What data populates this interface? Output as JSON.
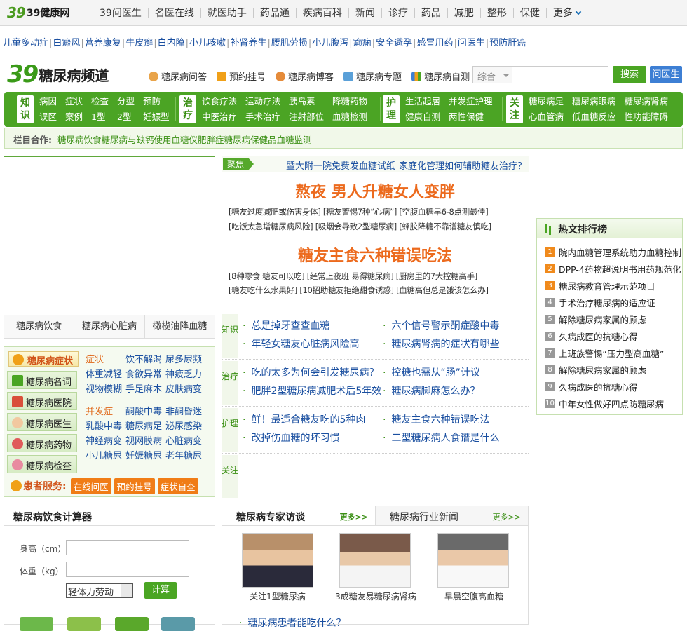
{
  "topnav": {
    "logo_mark": "39",
    "logo_text": "39健康网",
    "items": [
      "39问医生",
      "名医在线",
      "就医助手",
      "药品通",
      "疾病百科",
      "新闻",
      "诊疗",
      "药品",
      "减肥",
      "整形",
      "保健",
      "更多"
    ]
  },
  "quicklinks": [
    "儿童多动症",
    "白癜风",
    "营养康复",
    "牛皮癣",
    "白内障",
    "小儿咳嗽",
    "补肾养生",
    "腰肌劳损",
    "小儿腹泻",
    "癫痫",
    "安全避孕",
    "感冒用药",
    "问医生",
    "预防肝癌"
  ],
  "channel": {
    "logo_mark": "39",
    "name": "糖尿病频道",
    "links": [
      "糖尿病问答",
      "预约挂号",
      "糖尿病博客",
      "糖尿病专题",
      "糖尿病自测"
    ],
    "search_select": "综合",
    "search_button": "搜索",
    "ask_button": "问医生"
  },
  "greennav": {
    "sections": [
      {
        "badge": "知识",
        "items": [
          "病因",
          "症状",
          "检查",
          "分型",
          "预防",
          "误区",
          "案例",
          "1型",
          "2型",
          "妊娠型"
        ]
      },
      {
        "badge": "治疗",
        "items": [
          "饮食疗法",
          "运动疗法",
          "胰岛素",
          "降糖药物",
          "中医治疗",
          "手术治疗",
          "注射部位",
          "血糖检测"
        ]
      },
      {
        "badge": "护理",
        "items": [
          "生活起居",
          "并发症护理",
          "健康自测",
          "两性保健"
        ]
      },
      {
        "badge": "关注",
        "items": [
          "糖尿病足",
          "糖尿病眼病",
          "糖尿病肾病",
          "心血管病",
          "低血糖反应",
          "性功能障碍"
        ]
      }
    ]
  },
  "cooperation": {
    "label": "栏目合作:",
    "links": [
      "糖尿病饮食",
      "糖尿病与缺钙",
      "使用血糖仪",
      "肥胖症",
      "糖尿病保健品",
      "血糖监测"
    ]
  },
  "image_tabs": [
    "糖尿病饮食",
    "糖尿病心脏病",
    "橄榄油降血糖"
  ],
  "symptoms": {
    "head": "糖尿病症状",
    "side": [
      "糖尿病名词",
      "糖尿病医院",
      "糖尿病医生",
      "糖尿病药物",
      "糖尿病检查"
    ],
    "group1_label": "症状",
    "group1": [
      "饮不解渴",
      "尿多尿频",
      "体重减轻",
      "食欲异常",
      "神疲乏力",
      "视物模糊",
      "手足麻木",
      "皮肤病变"
    ],
    "group2_label": "并发症",
    "group2": [
      "酮酸中毒",
      "非酮昏迷",
      "乳酸中毒",
      "糖尿病足",
      "泌尿感染",
      "神经病变",
      "视网膜病",
      "心脏病变",
      "小儿糖尿",
      "妊娠糖尿",
      "老年糖尿"
    ],
    "patient_label": "患者服务:",
    "patient_buttons": [
      "在线问医",
      "预约挂号",
      "症状自查"
    ]
  },
  "calculator": {
    "title": "糖尿病饮食计算器",
    "height_label": "身高（cm）",
    "weight_label": "体重（kg）",
    "labor_select": "轻体力劳动",
    "calc_button": "计算"
  },
  "focus": {
    "tag": "聚焦",
    "links": [
      "暨大附一院免费发血糖试纸",
      "家庭化管理如何辅助糖友治疗？"
    ],
    "headline1": "熬夜 男人升糖女人变胖",
    "sub1a": "[糖友过度减肥或伤害身体] [糖友警惕7种“心病”] [空腹血糖早6-8点测最佳]",
    "sub1b": "[吃饭太急增糖尿病风险] [吸烟会导致2型糖尿病] [蜂胶降糖不靠谱糖友慎吃]",
    "headline2": "糖友主食六种错误吃法",
    "sub2a": "[8种零食 糖友可以吃] [经常上夜班 易得糖尿病] [厨房里的7大控糖高手]",
    "sub2b": "[糖友吃什么水果好] [10招助糖友拒绝甜食诱惑] [血糖高但总是饿该怎么办]"
  },
  "knowledge": [
    {
      "badge": "知识",
      "items": [
        "总是掉牙查查血糖",
        "六个信号警示酮症酸中毒",
        "年轻女糖友心脏病风险高",
        "糖尿病肾病的症状有哪些"
      ]
    },
    {
      "badge": "治疗",
      "items": [
        "吃的太多为何会引发糖尿病？",
        "控糖也需从“肠”计议",
        "肥胖2型糖尿病减肥术后5年效",
        "糖尿病脚麻怎么办？"
      ]
    },
    {
      "badge": "护理",
      "items": [
        "鲜！最适合糖友吃的5种肉",
        "糖友主食六种错误吃法",
        "改掉伤血糖的坏习惯",
        "二型糖尿病人食谱是什么"
      ]
    },
    {
      "badge": "关注",
      "items": []
    }
  ],
  "interview": {
    "tab1": "糖尿病专家访谈",
    "tab2": "糖尿病行业新闻",
    "more": "更多>>",
    "captions": [
      "关注1型糖尿病",
      "3成糖友易糖尿病肾病",
      "早晨空腹高血糖"
    ],
    "list_first": "糖尿病患者能吃什么？"
  },
  "hot": {
    "title": "热文排行榜",
    "items": [
      "院内血糖管理系统助力血糖控制",
      "DPP-4药物超说明书用药规范化",
      "糖尿病教育管理示范项目",
      "手术治疗糖尿病的适应证",
      "解除糖尿病家属的顾虑",
      "久病成医的抗糖心得",
      "上班族警惕“压力型高血糖”",
      "解除糖尿病家属的顾虑",
      "久病成医的抗糖心得",
      "中年女性做好四点防糖尿病"
    ],
    "nums": [
      "1",
      "2",
      "3",
      "4",
      "5",
      "6",
      "7",
      "8",
      "9",
      "10"
    ]
  },
  "colors": {
    "brand_green": "#4ba424",
    "link_blue": "#1a4fa0",
    "headline_orange": "#ec6a1d",
    "hot_orange": "#f08a1c",
    "hot_gray": "#999999"
  }
}
